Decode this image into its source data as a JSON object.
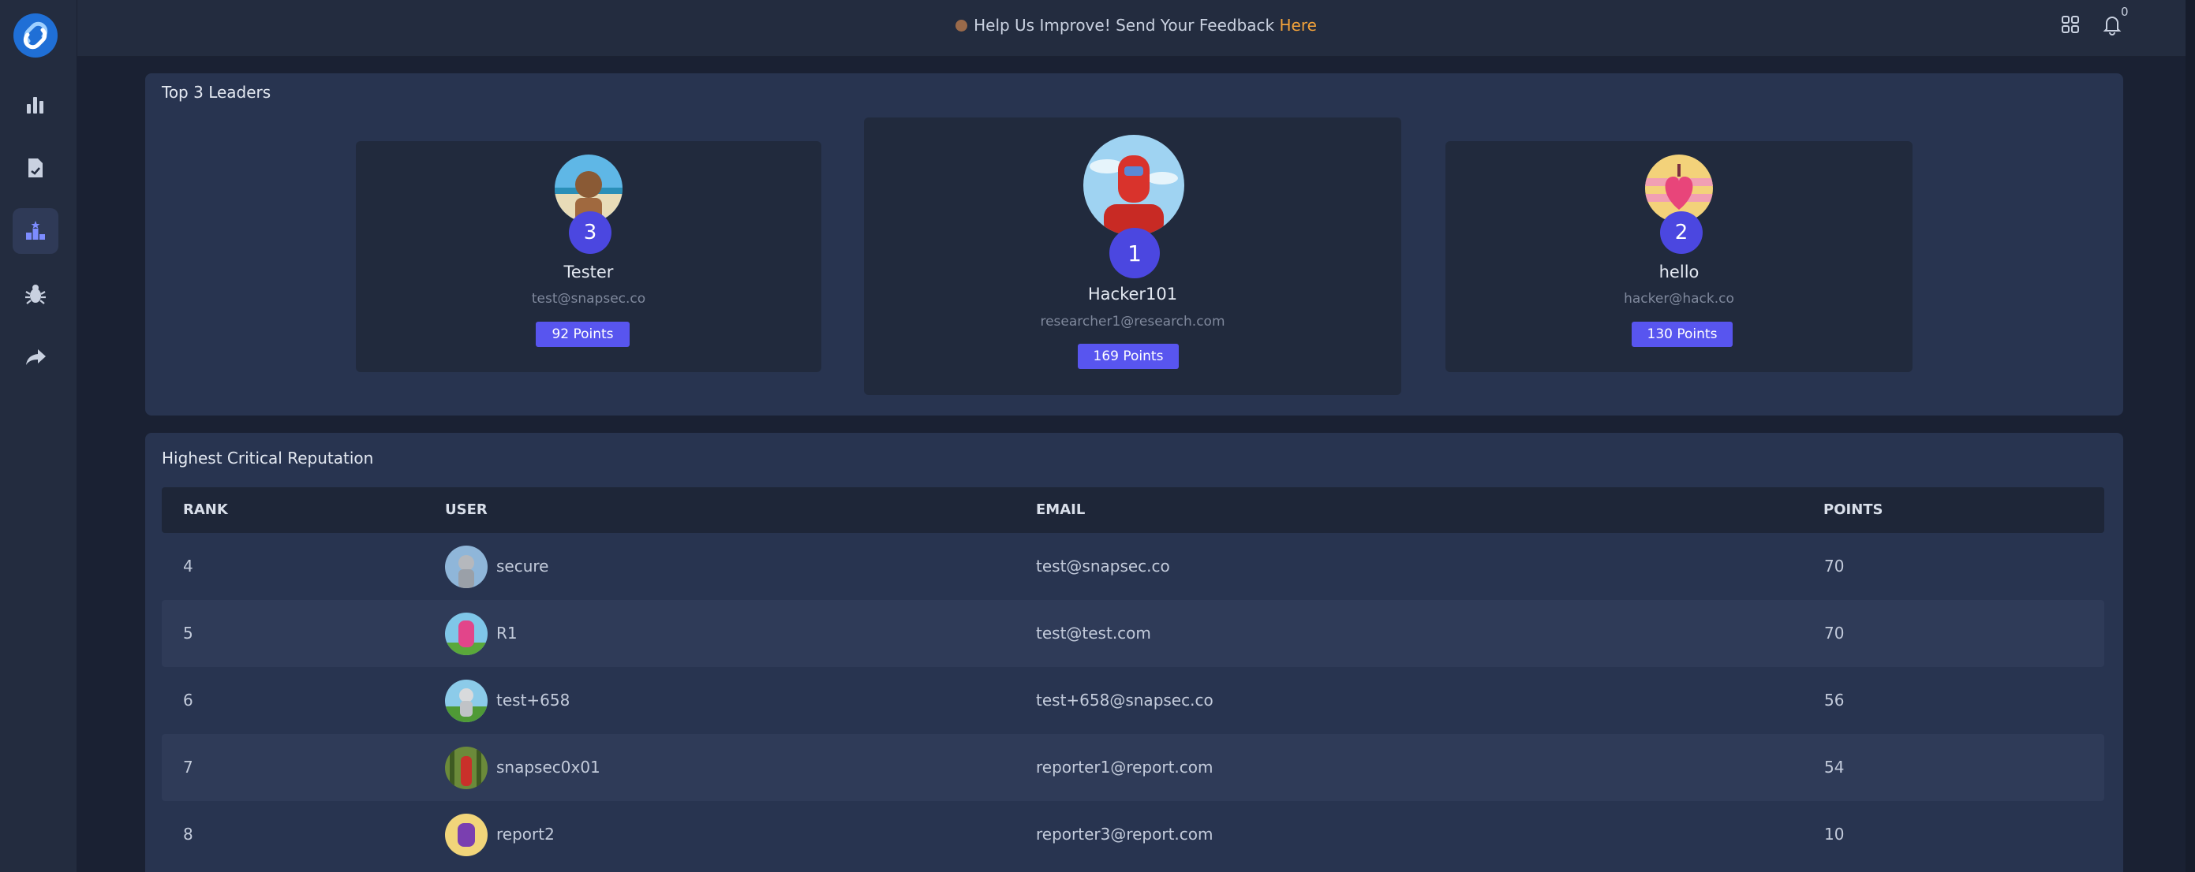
{
  "topbar": {
    "feedback_text": "Help Us Improve! Send Your Feedback ",
    "feedback_link": "Here",
    "notification_count": "0"
  },
  "sidebar": {
    "items": [
      "analytics-icon",
      "reports-icon",
      "leaderboard-icon",
      "bug-icon",
      "share-icon"
    ]
  },
  "leaders": {
    "title": "Top 3 Leaders",
    "first": {
      "rank": "1",
      "name": "Hacker101",
      "email": "researcher1@research.com",
      "points": "169 Points"
    },
    "second": {
      "rank": "2",
      "name": "hello",
      "email": "hacker@hack.co",
      "points": "130 Points"
    },
    "third": {
      "rank": "3",
      "name": "Tester",
      "email": "test@snapsec.co",
      "points": "92 Points"
    }
  },
  "reputation": {
    "title": "Highest Critical Reputation",
    "columns": [
      "RANK",
      "USER",
      "EMAIL",
      "POINTS"
    ],
    "rows": [
      {
        "rank": "4",
        "user": "secure",
        "email": "test@snapsec.co",
        "points": "70"
      },
      {
        "rank": "5",
        "user": "R1",
        "email": "test@test.com",
        "points": "70"
      },
      {
        "rank": "6",
        "user": "test+658",
        "email": "test+658@snapsec.co",
        "points": "56"
      },
      {
        "rank": "7",
        "user": "snapsec0x01",
        "email": "reporter1@report.com",
        "points": "54"
      },
      {
        "rank": "8",
        "user": "report2",
        "email": "reporter3@report.com",
        "points": "10"
      }
    ]
  },
  "colors": {
    "accent": "#5855ef",
    "badge": "#4b47e0",
    "link": "#f2a23a",
    "background": "#1a2133"
  }
}
